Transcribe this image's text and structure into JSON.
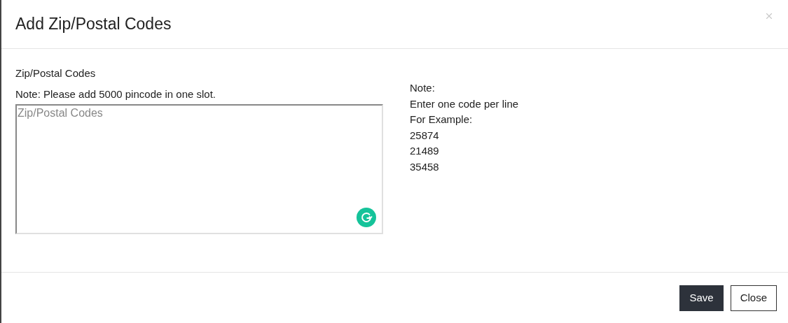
{
  "dialog": {
    "title": "Add Zip/Postal Codes"
  },
  "field": {
    "label": "Zip/Postal Codes",
    "note": "Note: Please add 5000 pincode in one slot.",
    "placeholder": "Zip/Postal Codes"
  },
  "help": [
    "Note:",
    "Enter one code per line",
    "For Example:",
    "25874",
    "21489",
    "35458"
  ],
  "buttons": [
    {
      "label": "Save",
      "kind": "primary"
    },
    {
      "label": "Close",
      "kind": "secondary"
    }
  ]
}
